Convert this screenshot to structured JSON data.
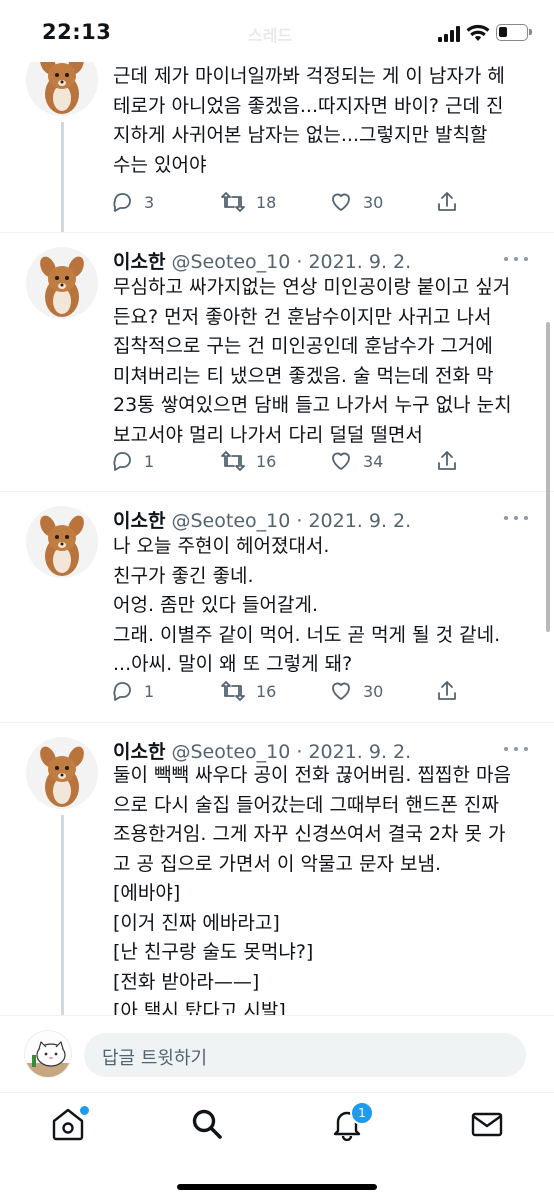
{
  "status_bar": {
    "time": "22:13",
    "title_ghost": "스레드",
    "battery_level": 0.35
  },
  "tweets": [
    {
      "name": "",
      "handle": "",
      "date": "",
      "text": "근데 제가 마이너일까봐 걱정되는 게 이 남자가 헤\n테로가 아니었음 좋겠음...따지자면 바이? 근데 진\n지하게 사귀어본 남자는 없는...그렇지만 발칙할\n수는 있어야",
      "replies": "3",
      "retweets": "18",
      "likes": "30"
    },
    {
      "name": "이소한",
      "handle": "@Seoteo_10",
      "date": "· 2021. 9. 2.",
      "text": "무심하고 싸가지없는 연상 미인공이랑 붙이고 싶거\n든요? 먼저 좋아한 건 훈남수이지만 사귀고 나서\n집착적으로 구는 건 미인공인데 훈남수가 그거에\n미쳐버리는 티 냈으면 좋겠음. 술 먹는데 전화 막\n23통 쌓여있으면 담배 들고 나가서 누구 없나 눈치\n보고서야 멀리 나가서 다리 덜덜 떨면서",
      "replies": "1",
      "retweets": "16",
      "likes": "34"
    },
    {
      "name": "이소한",
      "handle": "@Seoteo_10",
      "date": "· 2021. 9. 2.",
      "text": "나 오늘 주현이 헤어졌대서.\n친구가 좋긴 좋네.\n어엉. 좀만 있다 들어갈게.\n그래. 이별주 같이 먹어. 너도 곧 먹게 될 것 같네.\n...아씨. 말이 왜 또 그렇게 돼?",
      "replies": "1",
      "retweets": "16",
      "likes": "30"
    },
    {
      "name": "이소한",
      "handle": "@Seoteo_10",
      "date": "· 2021. 9. 2.",
      "text": "둘이 빽빽 싸우다 공이 전화 끊어버림. 찝찝한 마음\n으로 다시 술집 들어갔는데 그때부터 핸드폰 진짜\n조용한거임. 그게 자꾸 신경쓰여서 결국 2차 못 가\n고 공 집으로 가면서 이 악물고 문자 보냄.\n[에바야]\n[이거 진짜 에바라고]\n[난 친구랑 술도 못먹냐?]\n[전화 받아라——]\n[아 택시 탔다고 시발]",
      "replies": "",
      "retweets": "",
      "likes": ""
    }
  ],
  "reply_bar": {
    "placeholder": "답글 트윗하기"
  },
  "tab_bar": {
    "tabs": [
      {
        "name": "home",
        "icon": "home-icon",
        "has_dot": true
      },
      {
        "name": "search",
        "icon": "search-icon"
      },
      {
        "name": "notifications",
        "icon": "bell-icon",
        "badge": "1"
      },
      {
        "name": "messages",
        "icon": "mail-icon"
      }
    ]
  },
  "colors": {
    "accent": "#1d9bf0",
    "secondary_text": "#536471",
    "divider": "#eff3f4"
  }
}
